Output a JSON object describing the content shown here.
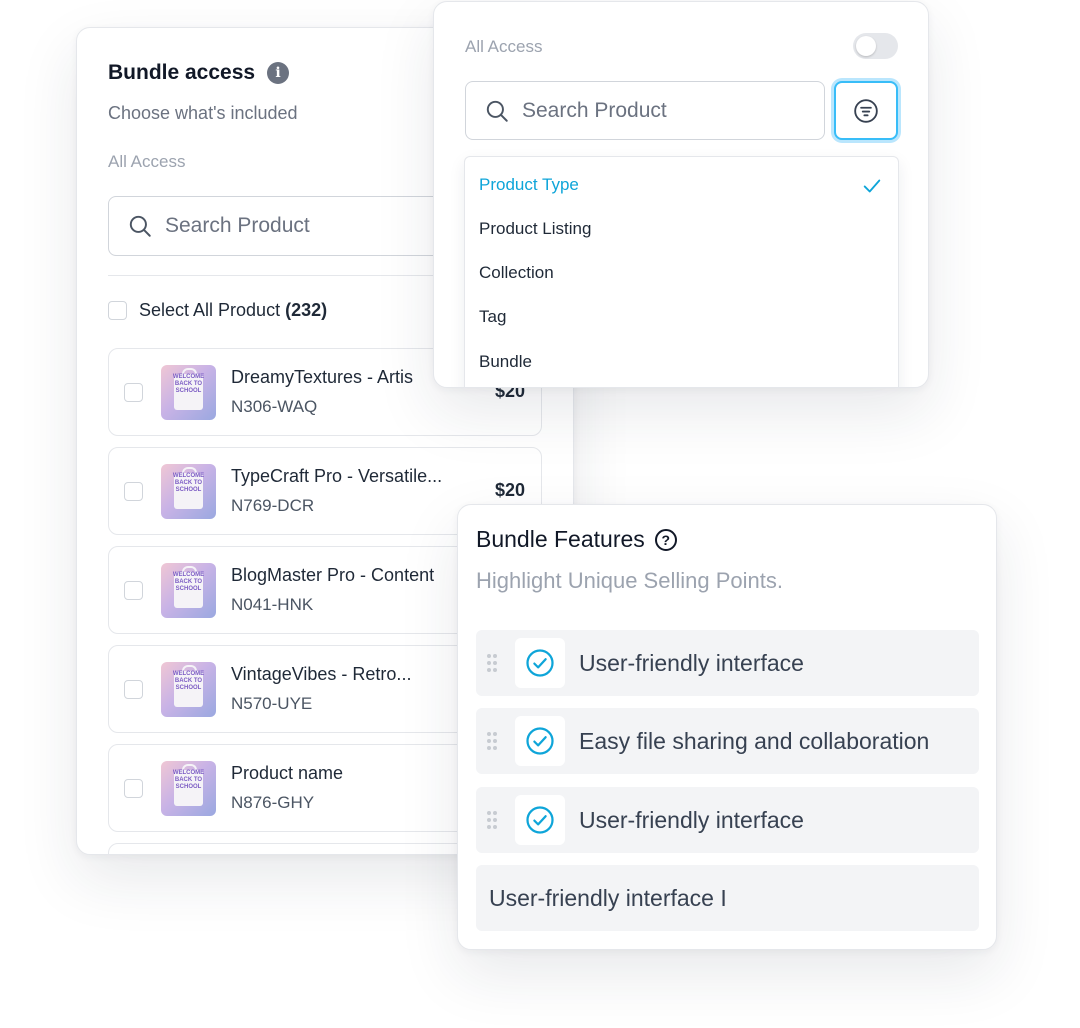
{
  "bundle_access": {
    "title": "Bundle access",
    "info_icon": "info-icon",
    "subtitle": "Choose what's included",
    "section_label": "All Access",
    "search_placeholder": "Search Product",
    "select_all_label": "Select All Product",
    "select_all_count": "(232)",
    "products": [
      {
        "name": "DreamyTextures - Artis",
        "sku": "N306-WAQ",
        "price": "$20"
      },
      {
        "name": "TypeCraft Pro - Versatile...",
        "sku": "N769-DCR",
        "price": "$20"
      },
      {
        "name": "BlogMaster Pro - Content",
        "sku": "N041-HNK",
        "price": ""
      },
      {
        "name": "VintageVibes - Retro...",
        "sku": "N570-UYE",
        "price": ""
      },
      {
        "name": "Product name",
        "sku": "N876-GHY",
        "price": ""
      }
    ],
    "thumb_text": [
      "WELCOME",
      "BACK TO",
      "SCHOOL"
    ]
  },
  "filter_panel": {
    "label": "All Access",
    "toggle_on": false,
    "search_placeholder": "Search Product",
    "filter_icon": "filter-icon",
    "options": [
      "Product Type",
      "Product Listing",
      "Collection",
      "Tag",
      "Bundle"
    ],
    "selected_option": "Product Type",
    "accent_color": "#0ea5d9"
  },
  "bundle_features": {
    "title": "Bundle Features",
    "help_icon": "question-icon",
    "subtitle": "Highlight Unique Selling Points.",
    "items": [
      "User-friendly interface",
      "Easy file sharing and collaboration",
      "User-friendly interface"
    ],
    "input_value": "User-friendly interface I"
  }
}
